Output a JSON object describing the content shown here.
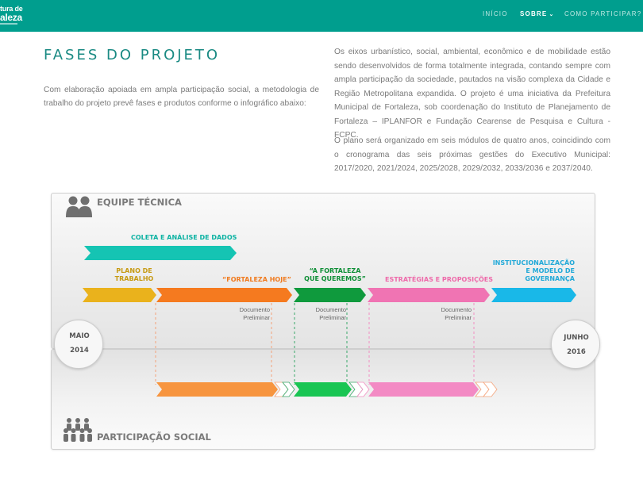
{
  "header": {
    "logo_line1": "tura de",
    "logo_line2": "aleza",
    "nav": [
      {
        "label": "INÍCIO"
      },
      {
        "label": "SOBRE",
        "chevron": "chevron-down-icon"
      },
      {
        "label": "COMO PARTICIPAR?"
      }
    ]
  },
  "main": {
    "title": "FASES DO PROJETO",
    "intro": "Com elaboração apoiada em ampla participação social, a metodologia de trabalho do projeto prevê fases e produtos conforme o infográfico abaixo:",
    "paragraphs": [
      "Os eixos urbanístico, social, ambiental, econômico e de mobilidade estão sendo desenvolvidos de forma totalmente integrada, contando sempre com ampla participação da sociedade, pautados na visão complexa da Cidade e Região Metropolitana expandida. O projeto é uma iniciativa da Prefeitura Municipal de Fortaleza, sob coordenação do Instituto de Planejamento de Fortaleza – IPLANFOR e Fundação Cearense de Pesquisa e Cultura - FCPC.",
      "O plano será organizado em seis módulos de quatro anos, coincidindo com o cronograma das seis próximas gestões do Executivo Municipal: 2017/2020, 2021/2024, 2025/2028, 2029/2032, 2033/2036 e 2037/2040."
    ]
  },
  "infographic": {
    "team_label": "EQUIPE TÉCNICA",
    "participation_label": "PARTICIPAÇÃO SOCIAL",
    "collection_label": "COLETA E ANÁLISE DE DADOS",
    "phases": [
      {
        "label": "PLANO DE\nTRABALHO",
        "color": "#c9a21a"
      },
      {
        "label": "“FORTALEZA HOJE”",
        "color": "#f07a1e"
      },
      {
        "label": "“A FORTALEZA\nQUE QUEREMOS”",
        "color": "#1a9c3e"
      },
      {
        "label": "ESTRATÉGIAS E PROPOSIÇÕES",
        "color": "#ee6aaa"
      },
      {
        "label": "INSTITUCIONALIZAÇÃO\nE MODELO DE\nGOVERNANÇA",
        "color": "#22a9d8"
      }
    ],
    "documents": [
      {
        "label": "Documento\nPreliminar"
      },
      {
        "label": "Documento\nPreliminar"
      },
      {
        "label": "Documento\nPreliminar"
      }
    ],
    "start": {
      "month": "MAIO",
      "year": "2014"
    },
    "end": {
      "month": "JUNHO",
      "year": "2016"
    },
    "colors": {
      "teal": "#15c4b3",
      "yellow": "#eab21c",
      "orange": "#f57a1f",
      "green": "#0f9a3d",
      "pink": "#f074b3",
      "blue": "#19b8e8",
      "brand": "#009e8e"
    },
    "icons": [
      "people-icon",
      "crowd-icon"
    ]
  }
}
